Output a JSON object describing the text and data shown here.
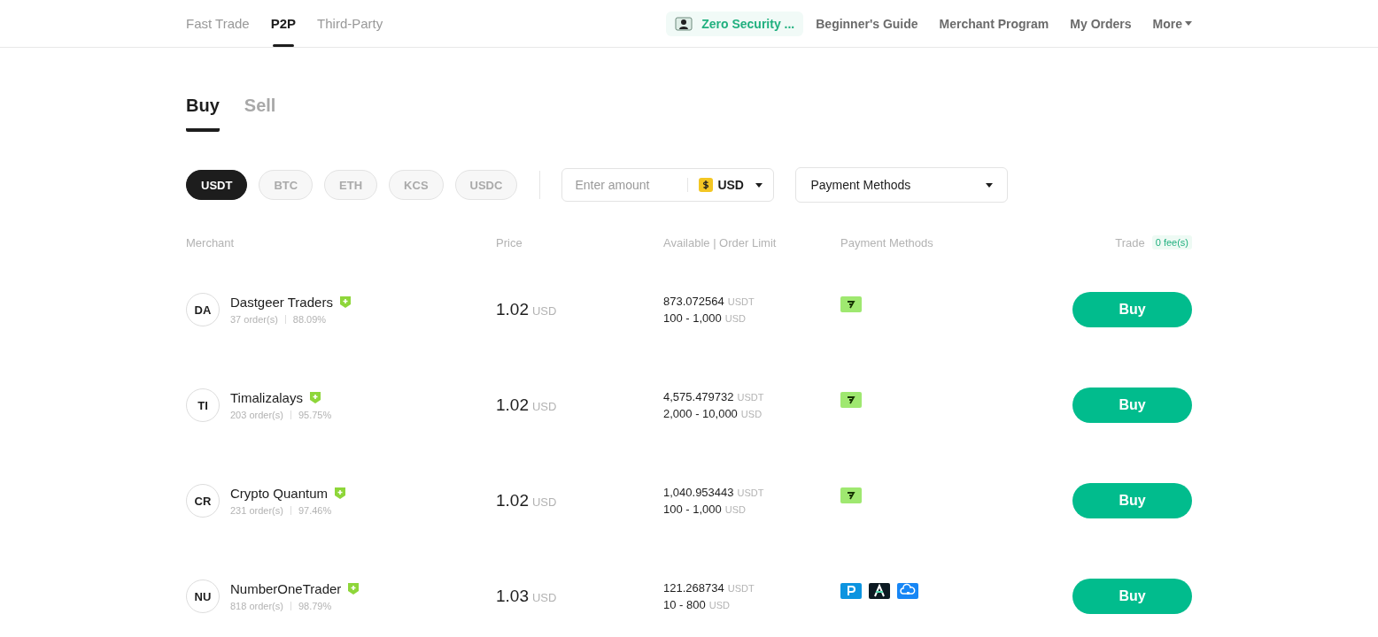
{
  "nav": {
    "tabs": [
      {
        "label": "Fast Trade",
        "selected": false
      },
      {
        "label": "P2P",
        "selected": true
      },
      {
        "label": "Third-Party",
        "selected": false
      }
    ],
    "promo": "Zero Security ...",
    "links": [
      "Beginner's Guide",
      "Merchant Program",
      "My Orders"
    ],
    "more": "More"
  },
  "side_tabs": [
    {
      "label": "Buy",
      "selected": true
    },
    {
      "label": "Sell",
      "selected": false
    }
  ],
  "coins": [
    {
      "label": "USDT",
      "selected": true
    },
    {
      "label": "BTC",
      "selected": false
    },
    {
      "label": "ETH",
      "selected": false
    },
    {
      "label": "KCS",
      "selected": false
    },
    {
      "label": "USDC",
      "selected": false
    }
  ],
  "amount": {
    "placeholder": "Enter amount",
    "currency": "USD"
  },
  "payment_select": "Payment Methods",
  "columns": [
    "Merchant",
    "Price",
    "Available | Order Limit",
    "Payment Methods",
    "Trade"
  ],
  "fee_badge": "0 fee(s)",
  "rows": [
    {
      "initials": "DA",
      "name": "Dastgeer Traders",
      "orders": "37 order(s)",
      "rate": "88.09%",
      "price": "1.02",
      "price_unit": "USD",
      "available": "873.072564",
      "available_unit": "USDT",
      "limit": "100 - 1,000",
      "limit_unit": "USD",
      "methods": [
        {
          "kind": "wise"
        }
      ],
      "action": "Buy"
    },
    {
      "initials": "TI",
      "name": "Timalizalays",
      "orders": "203 order(s)",
      "rate": "95.75%",
      "price": "1.02",
      "price_unit": "USD",
      "available": "4,575.479732",
      "available_unit": "USDT",
      "limit": "2,000 - 10,000",
      "limit_unit": "USD",
      "methods": [
        {
          "kind": "wise"
        }
      ],
      "action": "Buy"
    },
    {
      "initials": "CR",
      "name": "Crypto Quantum",
      "orders": "231 order(s)",
      "rate": "97.46%",
      "price": "1.02",
      "price_unit": "USD",
      "available": "1,040.953443",
      "available_unit": "USDT",
      "limit": "100 - 1,000",
      "limit_unit": "USD",
      "methods": [
        {
          "kind": "wise"
        }
      ],
      "action": "Buy"
    },
    {
      "initials": "NU",
      "name": "NumberOneTrader",
      "orders": "818 order(s)",
      "rate": "98.79%",
      "price": "1.03",
      "price_unit": "USD",
      "available": "121.268734",
      "available_unit": "USDT",
      "limit": "10 - 800",
      "limit_unit": "USD",
      "methods": [
        {
          "kind": "paypal"
        },
        {
          "kind": "airtm"
        },
        {
          "kind": "cloud"
        }
      ],
      "action": "Buy"
    }
  ]
}
